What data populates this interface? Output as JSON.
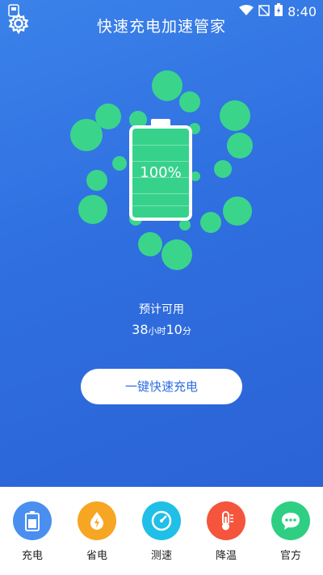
{
  "status_bar": {
    "time": "8:40"
  },
  "header": {
    "title": "快速充电加速管家"
  },
  "battery": {
    "percent_text": "100%",
    "level": 1.0
  },
  "estimate": {
    "label": "预计可用",
    "hours": "38",
    "hours_unit": "小时",
    "minutes": "10",
    "minutes_unit": "分"
  },
  "boost_button": {
    "label": "一键快速充电"
  },
  "bottom_nav": {
    "items": [
      {
        "label": "充电",
        "icon": "battery-charge-icon",
        "color": "#4a8ff0"
      },
      {
        "label": "省电",
        "icon": "power-save-icon",
        "color": "#f6a623"
      },
      {
        "label": "测速",
        "icon": "speedometer-icon",
        "color": "#1fbfe8"
      },
      {
        "label": "降温",
        "icon": "thermometer-icon",
        "color": "#f4553c"
      },
      {
        "label": "官方",
        "icon": "chat-icon",
        "color": "#2fcf83"
      }
    ]
  },
  "colors": {
    "background": "#2f6fe0",
    "bubble": "#3ad58b",
    "battery_fill": "#36d28c"
  }
}
